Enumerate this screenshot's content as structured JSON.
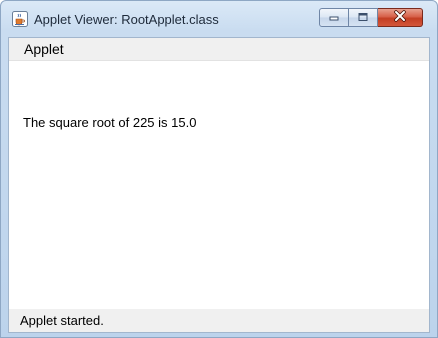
{
  "window": {
    "title": "Applet Viewer: RootApplet.class",
    "icon": "java-coffee-cup-icon"
  },
  "controls": {
    "minimize_icon": "minimize-icon",
    "maximize_icon": "maximize-icon",
    "close_icon": "close-icon"
  },
  "menubar": {
    "items": [
      {
        "label": "Applet"
      }
    ]
  },
  "applet": {
    "output": "The square root of 225 is 15.0"
  },
  "status": {
    "text": "Applet started."
  },
  "colors": {
    "frame": "#c9dcf0",
    "close_button": "#c94a30",
    "menubar": "#f0f0f0",
    "client": "#ffffff"
  }
}
